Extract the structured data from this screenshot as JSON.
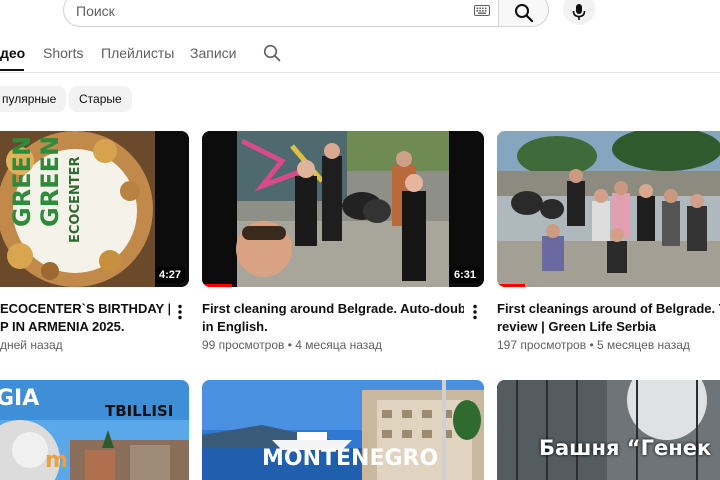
{
  "header": {
    "search_placeholder": "Поиск",
    "icons": [
      "keyboard-icon",
      "search-icon",
      "mic-icon"
    ]
  },
  "tabs": [
    {
      "label": "део",
      "active": true
    },
    {
      "label": "Shorts",
      "active": false
    },
    {
      "label": "Плейлисты",
      "active": false
    },
    {
      "label": "Записи",
      "active": false
    }
  ],
  "chips": [
    {
      "label": "пулярные"
    },
    {
      "label": "Старые"
    }
  ],
  "videos": [
    {
      "title_line1": "ECOCENTER`S BIRTHDAY |",
      "title_line2": "P IN ARMENIA 2025.",
      "meta": "дней назад",
      "duration": "4:27",
      "thumb_text_1": "GREEN",
      "thumb_text_2": "GREEN",
      "thumb_text_3": "ECOCENTER"
    },
    {
      "title_line1": "First cleaning around Belgrade. Auto-double",
      "title_line2": "in English.",
      "views": "99 просмотров",
      "age": "4 месяца назад",
      "duration": "6:31"
    },
    {
      "title_line1": "First cleanings around of Belgrade. The",
      "title_line2": "review | Green Life Serbia",
      "views": "197 просмотров",
      "age": "5 месяцев назад"
    },
    {
      "thumb_text_1": "GIA",
      "thumb_text_2": "TBILLISI",
      "thumb_text_3": "m"
    },
    {
      "thumb_text_1": "MONTENEGRO"
    },
    {
      "thumb_text_1": "Башня “Генек"
    }
  ],
  "colors": {
    "accent_red": "#ff0000",
    "chip_bg": "#f2f2f2",
    "text_secondary": "#606060"
  }
}
